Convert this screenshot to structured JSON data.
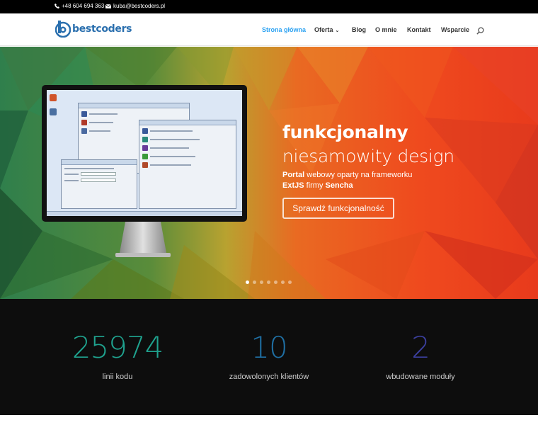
{
  "topbar": {
    "phone": "+48 604 694 363",
    "email": "kuba@bestcoders.pl",
    "phone_icon": "phone-icon",
    "email_icon": "envelope-icon"
  },
  "header": {
    "logo_text": "bestcoders",
    "nav": [
      {
        "label": "Strona główna",
        "active": true
      },
      {
        "label": "Oferta",
        "dropdown": true
      },
      {
        "label": "Blog"
      },
      {
        "label": "O mnie"
      },
      {
        "label": "Kontakt"
      },
      {
        "label": "Wsparcie"
      }
    ],
    "search_icon": "search-icon"
  },
  "hero": {
    "title_line1": "funkcjonalny",
    "title_line2": "niesamowity design",
    "desc_line1_bold": "Portal",
    "desc_line1_rest": " webowy oparty na frameworku",
    "desc_line2_bold1": "ExtJS",
    "desc_line2_mid": " firmy ",
    "desc_line2_bold2": "Sencha",
    "button_label": "Sprawdź funkcjonalność",
    "slides_count": 7,
    "active_slide": 1
  },
  "stats": [
    {
      "value": "25974",
      "label": "linii kodu",
      "color": "#1fa38f"
    },
    {
      "value": "10",
      "label": "zadowolonych klientów",
      "color": "#1f6fa3"
    },
    {
      "value": "2",
      "label": "wbudowane moduły",
      "color": "#3b3f9e"
    }
  ],
  "colors": {
    "accent": "#2ea3f2",
    "logo": "#2a6fae",
    "topbar_bg": "#000000",
    "stats_bg": "#0d0d0d"
  }
}
